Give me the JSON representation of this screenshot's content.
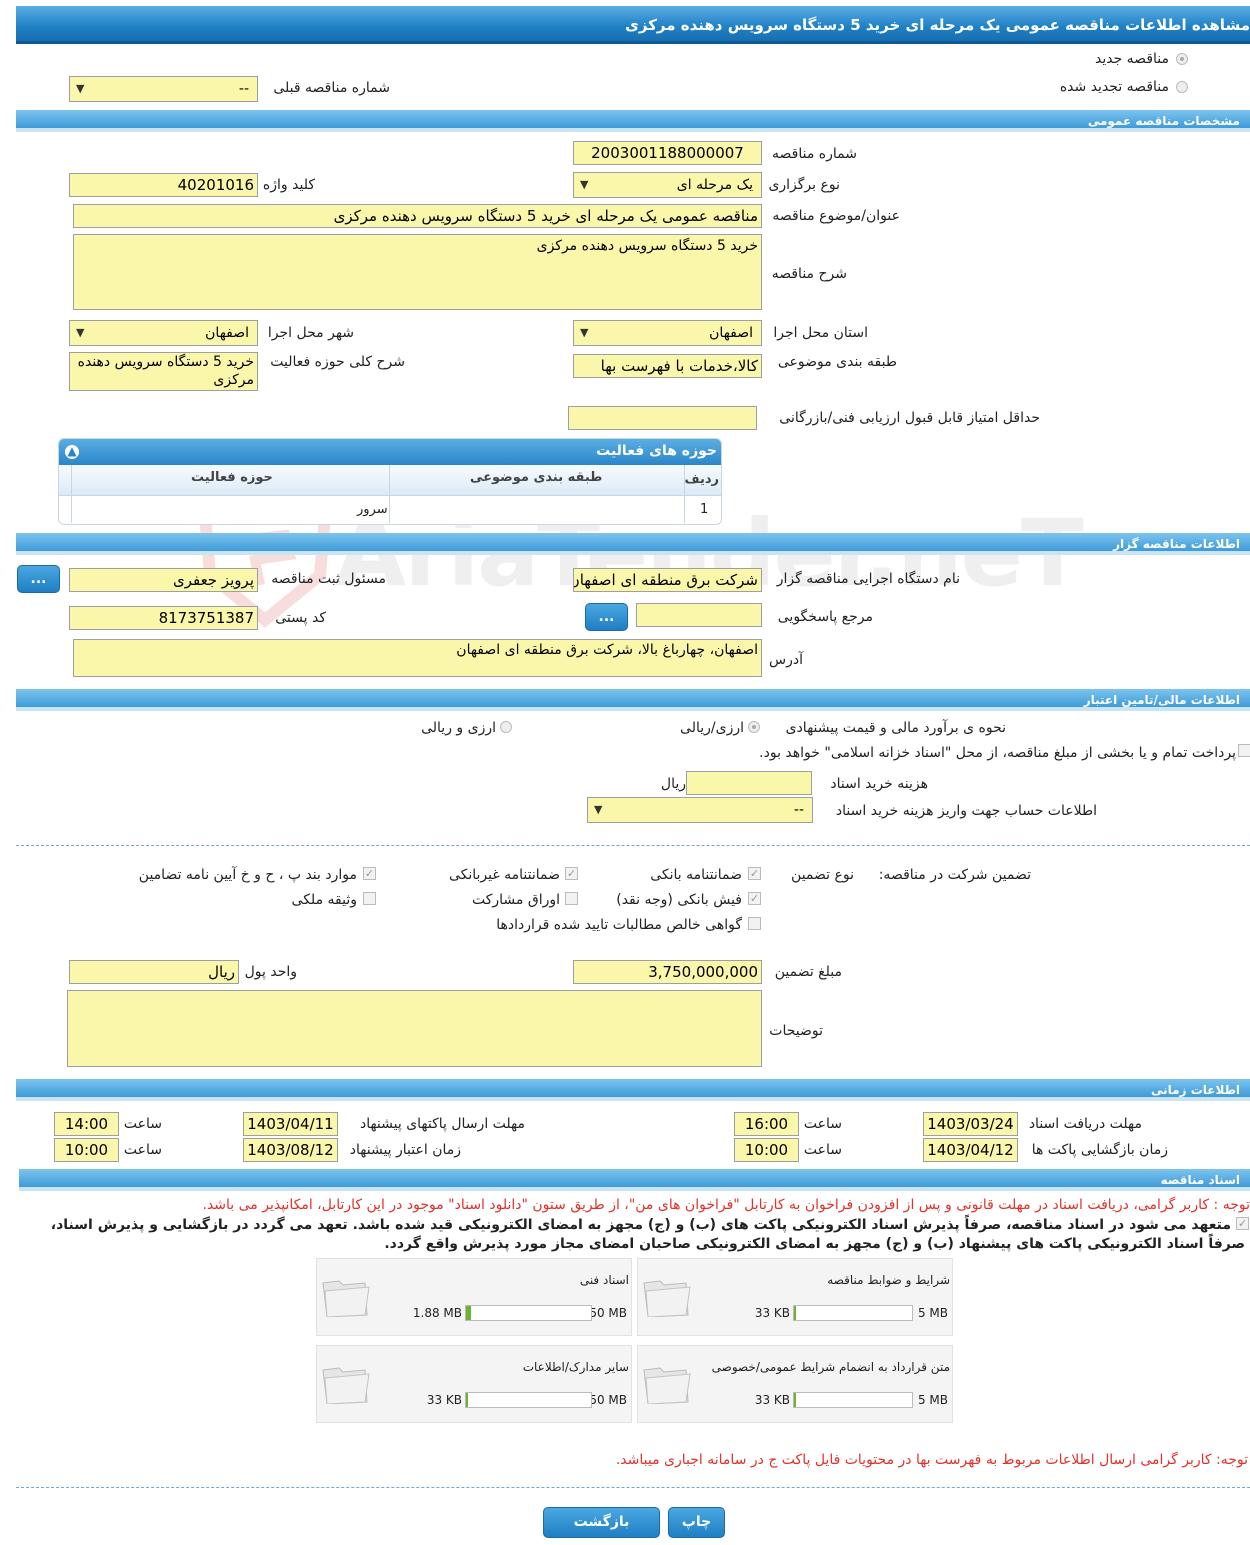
{
  "title": "مشاهده اطلاعات مناقصه عمومی یک مرحله ای خرید 5 دستگاه سرویس دهنده مرکزی",
  "top": {
    "radio_new": "مناقصه جدید",
    "radio_renewed": "مناقصه تجدید شده",
    "prev_tender_label": "شماره مناقصه قبلی",
    "prev_tender_value": "--"
  },
  "general": {
    "section": "مشخصات مناقصه عمومی",
    "number_label": "شماره مناقصه",
    "number_value": "2003001188000007",
    "type_label": "نوع برگزاری",
    "type_value": "یک مرحله ای",
    "keyword_label": "کلید واژه",
    "keyword_value": "40201016",
    "subject_label": "عنوان/موضوع مناقصه",
    "subject_value": "مناقصه عمومی یک مرحله ای خرید 5 دستگاه  سرویس دهنده مرکزی",
    "desc_label": "شرح مناقصه",
    "desc_value": "خرید 5 دستگاه  سرویس دهنده مرکزی",
    "province_label": "استان محل اجرا",
    "province_value": "اصفهان",
    "city_label": "شهر محل اجرا",
    "city_value": "اصفهان",
    "category_label": "طبقه بندی موضوعی",
    "category_value": "کالا،خدمات با فهرست بها",
    "activity_desc_label": "شرح کلی حوزه فعالیت",
    "activity_desc_value": "خرید 5 دستگاه  سرویس دهنده مرکزی",
    "min_score_label": "حداقل امتیاز قابل قبول ارزیابی فنی/بازرگانی",
    "min_score_value": ""
  },
  "activity_grid": {
    "title": "حوزه های فعالیت",
    "col_row": "ردیف",
    "col_category": "طبقه بندی موضوعی",
    "col_field": "حوزه فعالیت",
    "rows": [
      {
        "row": "1",
        "category": "",
        "field": "سرور"
      }
    ]
  },
  "organizer": {
    "section": "اطلاعات مناقصه گزار",
    "org_label": "نام دستگاه اجرایی مناقصه گزار",
    "org_value": "شرکت برق منطقه ای اصفهان",
    "registrar_label": "مسئول ثبت مناقصه",
    "registrar_value": "پرویز جعفری",
    "ref_label": "مرجع پاسخگویی",
    "ref_value": "",
    "postal_label": "کد پستی",
    "postal_value": "8173751387",
    "address_label": "آدرس",
    "address_value": "اصفهان، چهارباغ بالا، شرکت برق منطقه ای اصفهان",
    "more_btn": "..."
  },
  "finance": {
    "section": "اطلاعات مالی/تامین اعتبار",
    "estimate_label": "نحوه ی برآورد مالی و قیمت پیشنهادی",
    "opt_fx_rial": "ارزی/ریالی",
    "opt_fx_and_rial": "ارزی و ریالی",
    "treasury_text": "پرداخت تمام و یا بخشی از مبلغ مناقصه، از محل \"اسناد خزانه اسلامی\" خواهد بود.",
    "doc_cost_label": "هزینه خرید اسناد",
    "doc_cost_value": "",
    "doc_cost_unit": "ریال",
    "account_label": "اطلاعات حساب جهت واریز هزینه خرید اسناد",
    "account_value": "--"
  },
  "guarantee": {
    "label": "تضمین شرکت در مناقصه:",
    "type_label": "نوع تضمین",
    "bank_guarantee": "ضمانتنامه بانکی",
    "nonbank_guarantee": "ضمانتنامه غیربانکی",
    "regulation_items": "موارد بند پ ، ح و خ آیین نامه تضامین",
    "cash_receipt": "فیش بانکی (وجه نقد)",
    "bonds": "اوراق مشارکت",
    "property": "وثیقه ملکی",
    "receivables": "گواهی خالص مطالبات تایید شده قراردادها",
    "amount_label": "مبلغ تضمین",
    "amount_value": "3,750,000,000",
    "currency_label": "واحد پول",
    "currency_value": "ریال",
    "notes_label": "توضیحات",
    "notes_value": ""
  },
  "timing": {
    "section": "اطلاعات زمانی",
    "doc_deadline_label": "مهلت دریافت اسناد",
    "doc_deadline_date": "1403/03/24",
    "doc_deadline_time": "16:00",
    "send_deadline_label": "مهلت ارسال پاکتهای پیشنهاد",
    "send_deadline_date": "1403/04/11",
    "send_deadline_time": "14:00",
    "opening_label": "زمان بازگشایی پاکت ها",
    "opening_date": "1403/04/12",
    "opening_time": "10:00",
    "validity_label": "زمان اعتبار پیشنهاد",
    "validity_date": "1403/08/12",
    "validity_time": "10:00",
    "time_label": "ساعت"
  },
  "documents": {
    "section": "اسناد مناقصه",
    "notice1": "توجه : کاربر گرامی، دریافت اسناد در مهلت قانونی و پس از افزودن فراخوان به کارتابل \"فراخوان های من\"، از طریق ستون \"دانلود اسناد\" موجود در این کارتابل، امکانپذیر می باشد.",
    "commit_line1": "متعهد می شود در اسناد مناقصه، صرفاً پذیرش اسناد الکترونیکی پاکت های (ب) و (ج) مجهز به امضای الکترونیکی قید شده باشد. تعهد می گردد در بازگشایی و پذیرش اسناد،",
    "commit_line2": "صرفاً اسناد الکترونیکی پاکت های پیشنهاد (ب) و (ج) مجهز به امضای الکترونیکی صاحبان امضای مجاز مورد پذیرش واقع گردد.",
    "files": [
      {
        "name": "شرایط و ضوابط مناقصه",
        "size": "33 KB",
        "max": "5 MB",
        "fill": 0.01
      },
      {
        "name": "اسناد فنی",
        "size": "1.88 MB",
        "max": "50 MB",
        "fill": 0.04
      },
      {
        "name": "متن قرارداد به انضمام شرایط عمومی/خصوصی",
        "size": "33 KB",
        "max": "5 MB",
        "fill": 0.01
      },
      {
        "name": "سایر مدارک/اطلاعات",
        "size": "33 KB",
        "max": "50 MB",
        "fill": 0.005
      }
    ],
    "notice2": "توجه: کاربر گرامی ارسال اطلاعات مربوط به فهرست بها در محتویات فایل پاکت ج در سامانه اجباری میباشد."
  },
  "buttons": {
    "print": "چاپ",
    "back": "بازگشت"
  },
  "watermark": "AriaTender.neT"
}
